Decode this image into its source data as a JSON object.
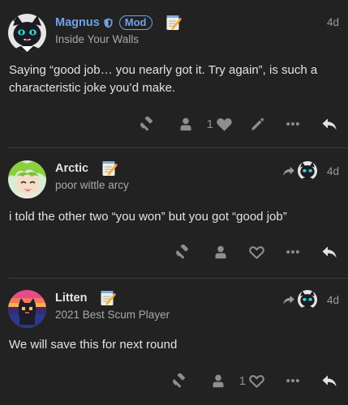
{
  "posts": [
    {
      "username": "Magnus",
      "badge": "Mod",
      "user_title": "Inside Your Walls",
      "date": "4d",
      "content": "Saying “good job… you nearly got it. Try again”, is such a characteristic joke you’d make.",
      "like_count": "1",
      "avatar": "cat-avatar-black-cyan-eyes",
      "actions": [
        "flag-icon",
        "assign-icon",
        "like-icon",
        "edit-icon",
        "more-icon",
        "reply-icon"
      ]
    },
    {
      "username": "Arctic",
      "user_title": "poor wittle arcy",
      "date": "4d",
      "content": "i told the other two “you won” but you got “good job”",
      "like_count": "",
      "avatar": "anime-green-hair-avatar",
      "actions": [
        "flag-icon",
        "assign-icon",
        "like-icon",
        "more-icon",
        "reply-icon"
      ]
    },
    {
      "username": "Litten",
      "user_title": "2021 Best Scum Player",
      "date": "4d",
      "content": "We will save this for next round",
      "like_count": "1",
      "avatar": "pixel-cat-sunset-avatar",
      "actions": [
        "flag-icon",
        "assign-icon",
        "like-icon",
        "more-icon",
        "reply-icon"
      ]
    }
  ],
  "colors": {
    "background": "#222222",
    "mod_accent": "#6ea2e8",
    "icon": "#8e8e8e",
    "text": "#e2e2e2",
    "muted": "#a8a8a8"
  }
}
